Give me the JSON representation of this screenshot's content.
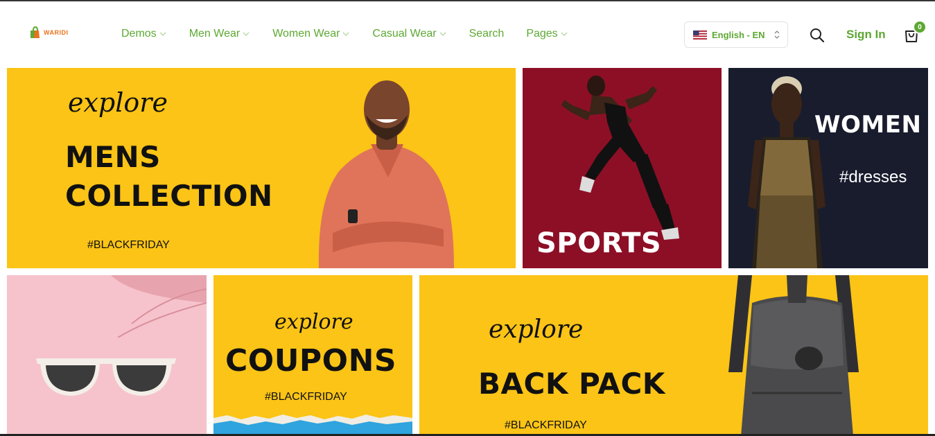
{
  "brand": {
    "name": "WARIDI",
    "accent": "#5da833",
    "logo_color": "#e8721c"
  },
  "nav": [
    {
      "label": "Demos",
      "dropdown": true
    },
    {
      "label": "Men Wear",
      "dropdown": true
    },
    {
      "label": "Women Wear",
      "dropdown": true
    },
    {
      "label": "Casual Wear",
      "dropdown": true
    },
    {
      "label": "Search",
      "dropdown": false
    },
    {
      "label": "Pages",
      "dropdown": true
    }
  ],
  "language": {
    "label": "English - EN",
    "flag": "us-flag-icon"
  },
  "header": {
    "signin_label": "Sign In",
    "cart_count": "0"
  },
  "tiles": {
    "mens": {
      "script": "explore",
      "line1": "MENS",
      "line2": "COLLECTION",
      "tag": "#BLACKFRIDAY"
    },
    "sports": {
      "title": "SPORTS"
    },
    "women": {
      "title": "WOMEN",
      "tag": "#dresses"
    },
    "sunglasses": {},
    "coupons": {
      "script": "explore",
      "title": "COUPONS",
      "tag": "#BLACKFRIDAY"
    },
    "backpack": {
      "script": "explore",
      "title": "BACK PACK",
      "tag": "#BLACKFRIDAY"
    }
  }
}
